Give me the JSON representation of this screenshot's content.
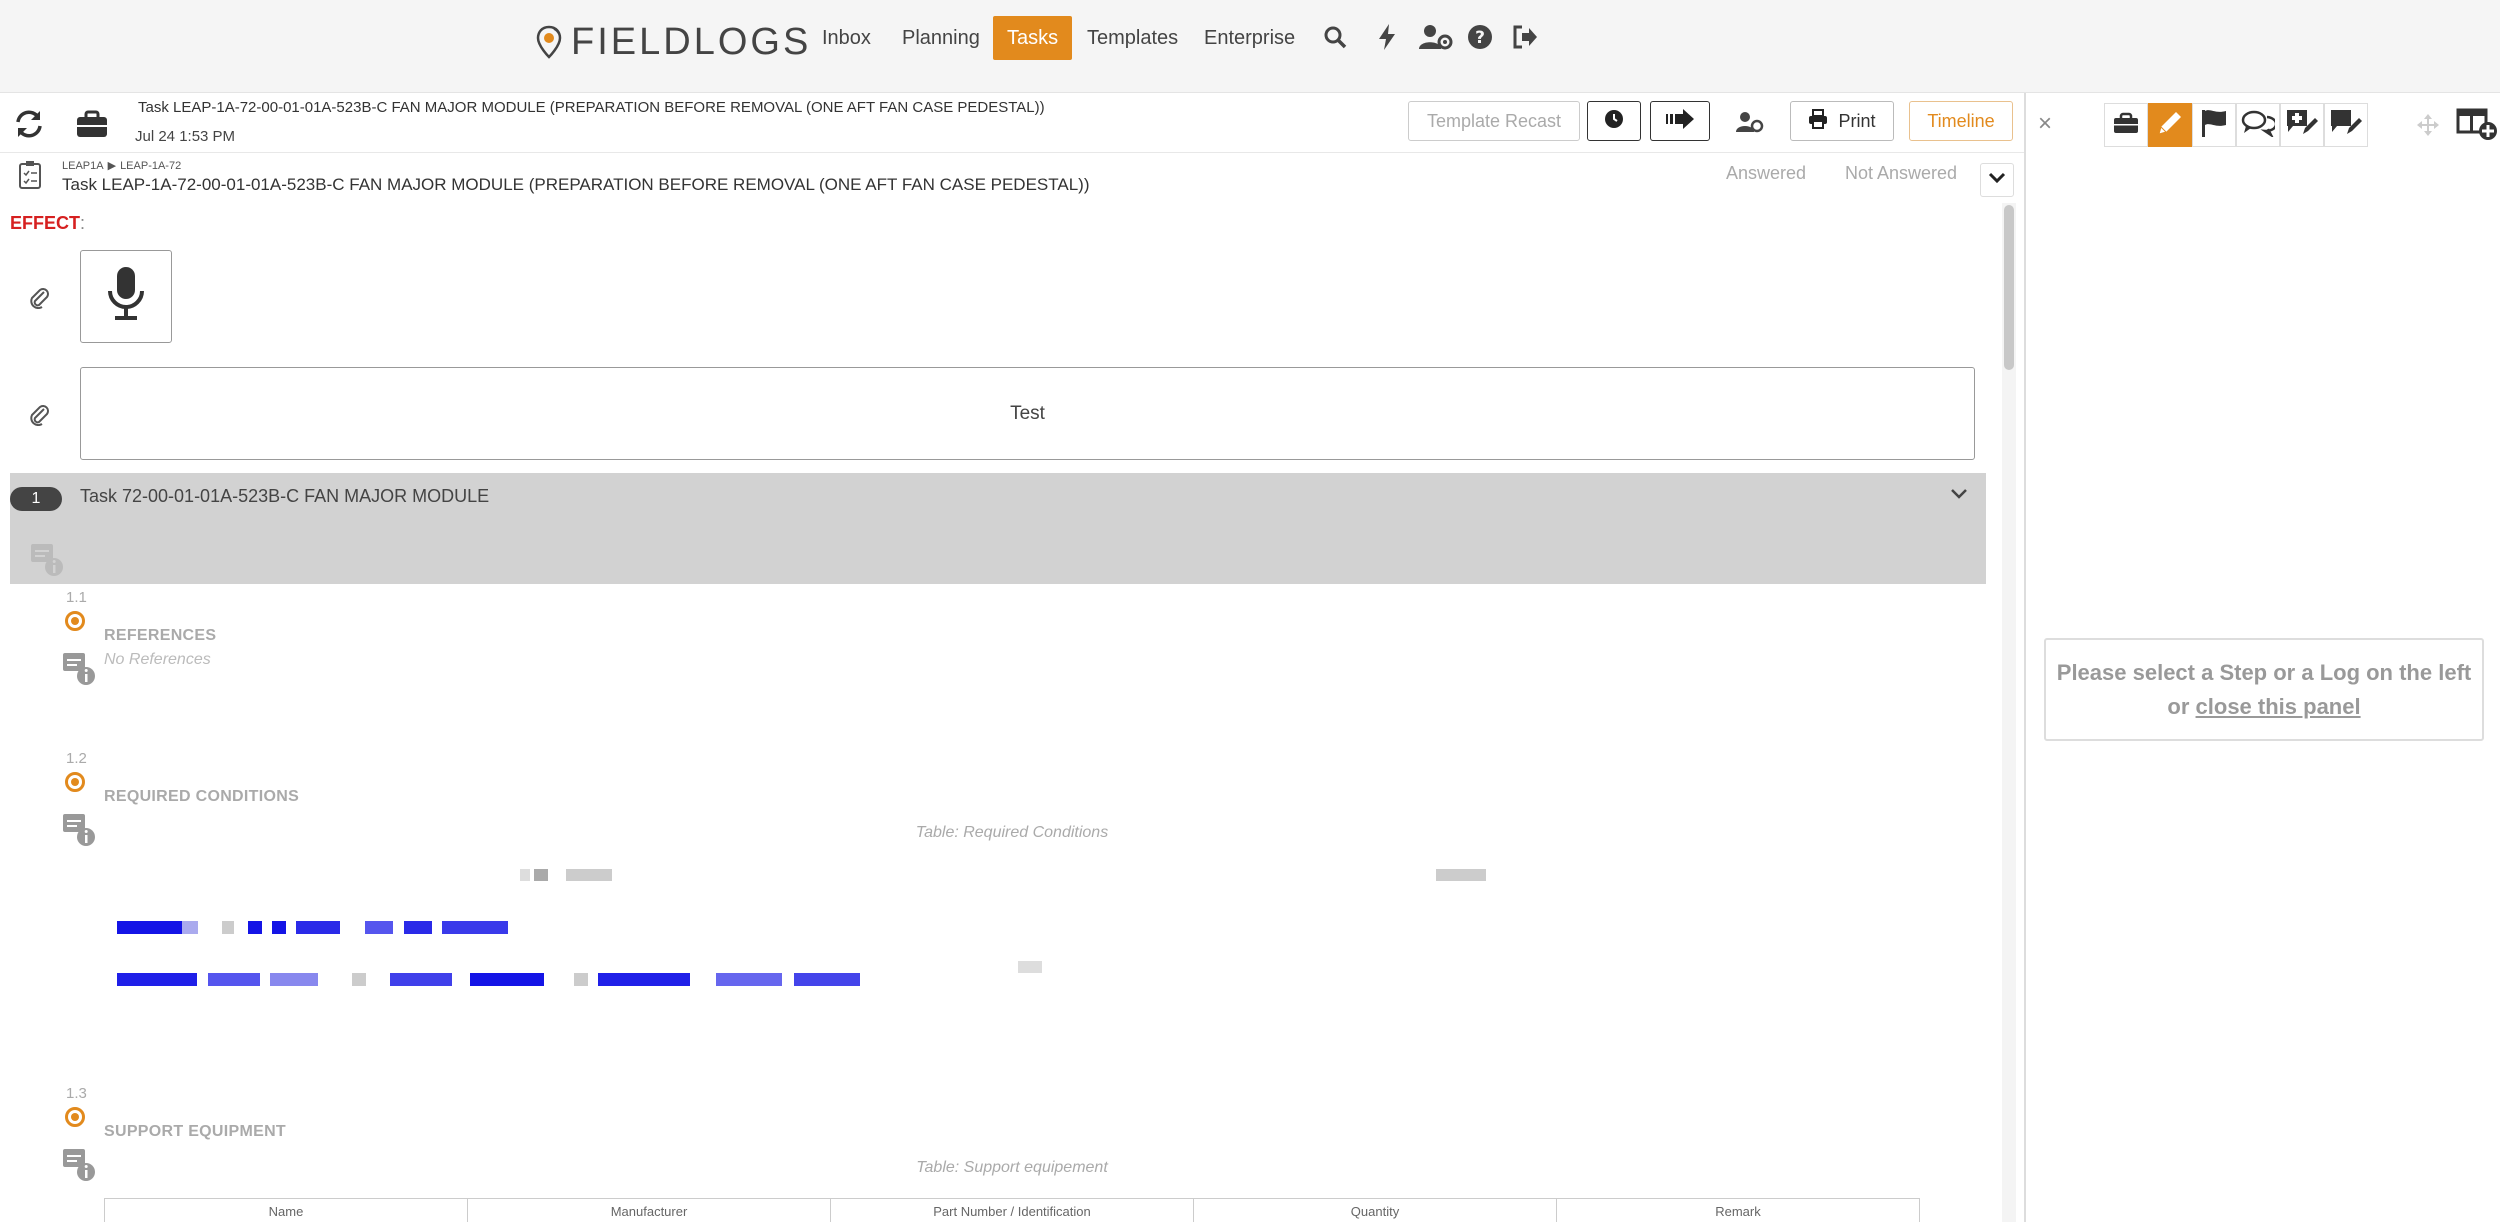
{
  "app": {
    "logo_text": "FIELDLOGS",
    "nav": [
      {
        "label": "Inbox"
      },
      {
        "label": "Planning"
      },
      {
        "label": "Tasks"
      },
      {
        "label": "Templates"
      },
      {
        "label": "Enterprise"
      }
    ],
    "nav_icons": [
      "search-icon",
      "bolt-icon",
      "user-settings-icon",
      "help-icon",
      "sign-out-icon"
    ],
    "accent_color": "#e28a1d"
  },
  "taskbar": {
    "title": "Task LEAP-1A-72-00-01-01A-523B-C FAN MAJOR MODULE (PREPARATION BEFORE REMOVAL (ONE AFT FAN CASE PEDESTAL))",
    "date": "Jul 24 1:53 PM",
    "template_recast_label": "Template Recast",
    "print_label": "Print",
    "timeline_label": "Timeline"
  },
  "main": {
    "breadcrumb": [
      "LEAP1A",
      "LEAP-1A-72"
    ],
    "subtitle": "Task LEAP-1A-72-00-01-01A-523B-C FAN MAJOR MODULE (PREPARATION BEFORE REMOVAL (ONE AFT FAN CASE PEDESTAL))",
    "filter_answered": "Answered",
    "filter_not_answered": "Not Answered",
    "effect_label": "EFFECT",
    "effect_suffix": ":",
    "text_answer": "Test",
    "section": {
      "number": "1",
      "title": "Task 72-00-01-01A-523B-C FAN MAJOR MODULE"
    },
    "steps": [
      {
        "number": "1.1",
        "title": "REFERENCES",
        "note": "No References"
      },
      {
        "number": "1.2",
        "title": "REQUIRED CONDITIONS",
        "table_caption": "Table: Required Conditions"
      },
      {
        "number": "1.3",
        "title": "SUPPORT EQUIPMENT",
        "table_caption": "Table: Support equipement"
      }
    ],
    "equipment_columns": [
      "Name",
      "Manufacturer",
      "Part Number / Identification",
      "Quantity",
      "Remark"
    ]
  },
  "right_panel": {
    "message_line1": "Please select a Step or a Log on the left",
    "message_or": "or",
    "close_link": "close this panel"
  }
}
